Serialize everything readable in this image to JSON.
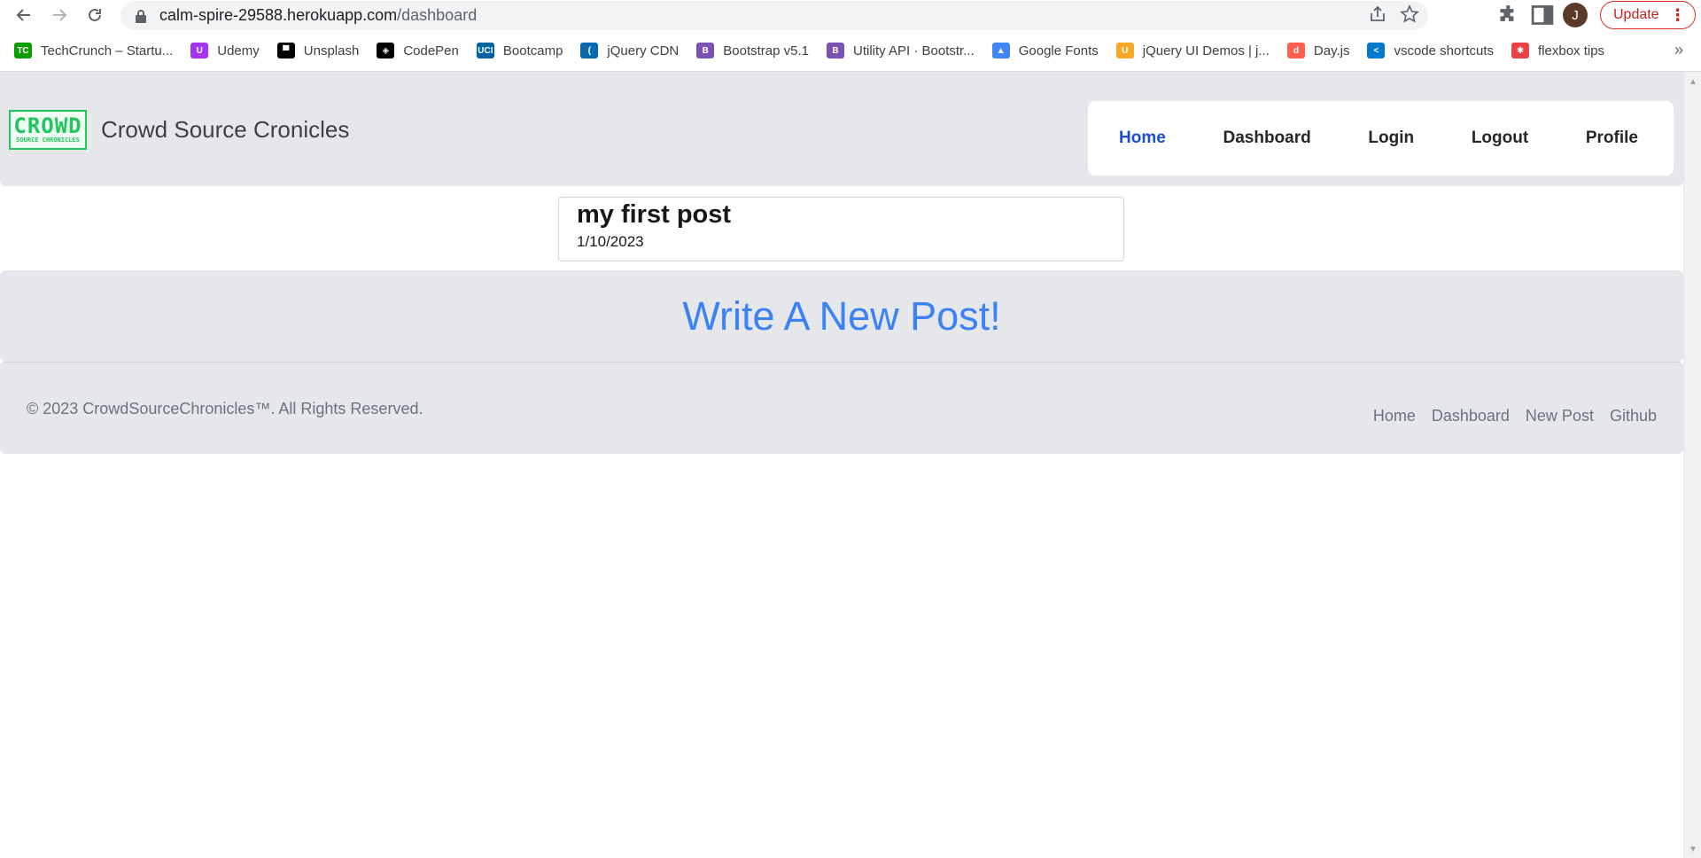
{
  "browser": {
    "url_host": "calm-spire-29588.herokuapp.com",
    "url_path": "/dashboard",
    "profile_initial": "J",
    "update_label": "Update"
  },
  "bookmarks": [
    {
      "label": "TechCrunch – Startu...",
      "icon": "techcrunch-icon",
      "color": "#0a9e01",
      "glyph": "TC"
    },
    {
      "label": "Udemy",
      "icon": "udemy-icon",
      "color": "#a435f0",
      "glyph": "U"
    },
    {
      "label": "Unsplash",
      "icon": "unsplash-icon",
      "color": "#000000",
      "glyph": "▀"
    },
    {
      "label": "CodePen",
      "icon": "codepen-icon",
      "color": "#000000",
      "glyph": "◈"
    },
    {
      "label": "Bootcamp",
      "icon": "uci-icon",
      "color": "#0064a4",
      "glyph": "UCI"
    },
    {
      "label": "jQuery CDN",
      "icon": "jquery-icon",
      "color": "#0769ad",
      "glyph": "("
    },
    {
      "label": "Bootstrap v5.1",
      "icon": "bootstrap-icon",
      "color": "#7952b3",
      "glyph": "B"
    },
    {
      "label": "Utility API · Bootstr...",
      "icon": "bootstrap-icon",
      "color": "#7952b3",
      "glyph": "B"
    },
    {
      "label": "Google Fonts",
      "icon": "google-fonts-icon",
      "color": "#4285f4",
      "glyph": "▲"
    },
    {
      "label": "jQuery UI Demos | j...",
      "icon": "jquery-ui-icon",
      "color": "#f6a828",
      "glyph": "U"
    },
    {
      "label": "Day.js",
      "icon": "dayjs-icon",
      "color": "#ff5f4c",
      "glyph": "d"
    },
    {
      "label": "vscode shortcuts",
      "icon": "vscode-icon",
      "color": "#007acc",
      "glyph": "<"
    },
    {
      "label": "flexbox tips",
      "icon": "flexbox-icon",
      "color": "#e84343",
      "glyph": "✱"
    }
  ],
  "site": {
    "logo_big": "CROWD",
    "logo_small": "SOURCE CHRONICLES",
    "brand": "Crowd Source Cronicles",
    "nav": {
      "home": "Home",
      "dashboard": "Dashboard",
      "login": "Login",
      "logout": "Logout",
      "profile": "Profile"
    }
  },
  "posts": [
    {
      "title": "my first post",
      "date": "1/10/2023"
    }
  ],
  "new_post_label": "Write A New Post!",
  "footer": {
    "copyright": "© 2023 CrowdSourceChronicles™. All Rights Reserved.",
    "links": {
      "home": "Home",
      "dashboard": "Dashboard",
      "new_post": "New Post",
      "github": "Github"
    }
  },
  "colors": {
    "header_bg": "#e5e7eb",
    "nav_active": "#1d4ed8",
    "new_post_link": "#3b82f6",
    "logo_green": "#22c55e"
  }
}
